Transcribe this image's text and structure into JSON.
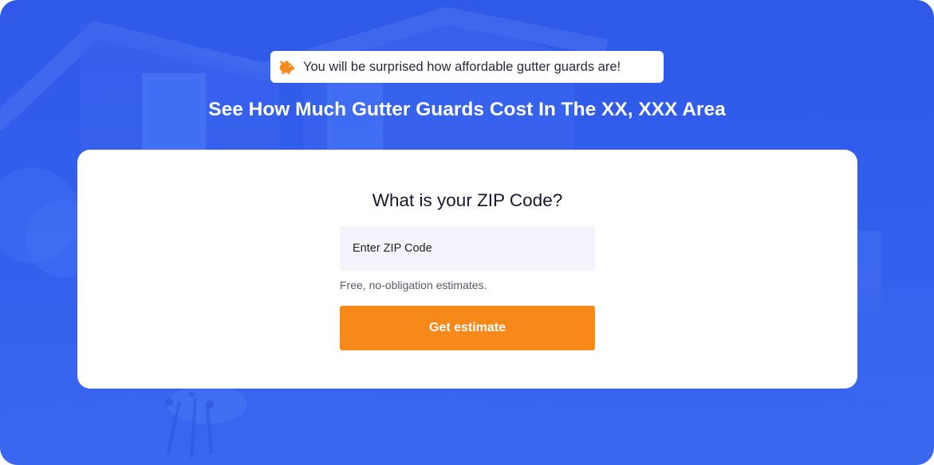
{
  "banner": {
    "icon": "piggy-bank-icon",
    "text": "You will be surprised how affordable gutter guards are!"
  },
  "headline": "See How Much Gutter Guards Cost In The XX, XXX Area",
  "form": {
    "question": "What is your ZIP Code?",
    "zip_placeholder": "Enter ZIP Code",
    "zip_value": "",
    "note": "Free, no-obligation estimates.",
    "submit_label": "Get estimate"
  },
  "colors": {
    "background": "#3460ee",
    "accent": "#f7891a",
    "card": "#ffffff",
    "input_bg": "#f4f5fc"
  }
}
